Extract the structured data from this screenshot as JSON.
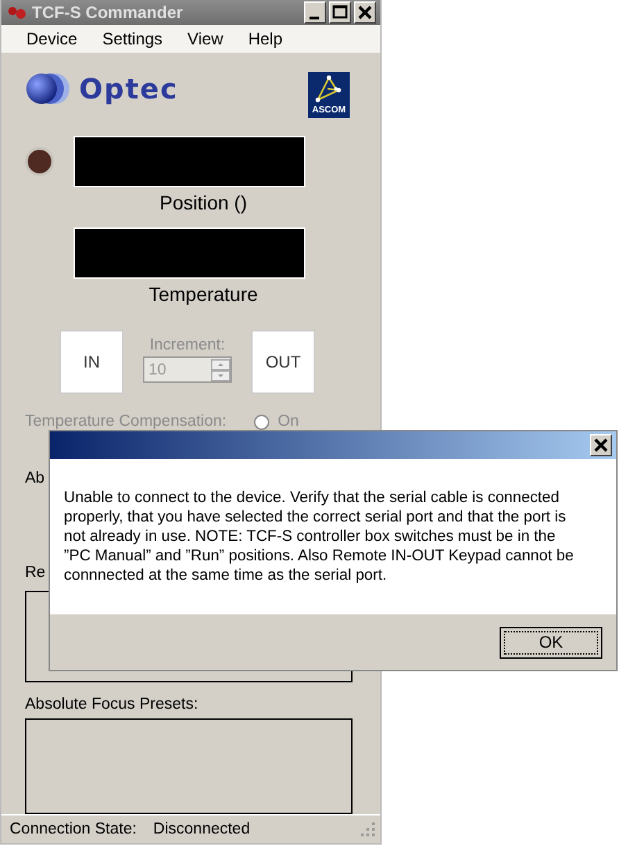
{
  "window": {
    "title": "TCF-S Commander",
    "active": false
  },
  "menu": [
    "Device",
    "Settings",
    "View",
    "Help"
  ],
  "logo": {
    "text": "Optec",
    "badge": "ASCOM"
  },
  "led": {
    "on": false
  },
  "position": {
    "label": "Position ()"
  },
  "temperature": {
    "label": "Temperature"
  },
  "move": {
    "in_button": "IN",
    "out_button": "OUT",
    "increment_label": "Increment:",
    "increment_value": "10",
    "disabled": true
  },
  "temp_compensation": {
    "label": "Temperature Compensation:",
    "option": "On",
    "checked": false,
    "disabled": true
  },
  "hidden_labels": [
    "Ab",
    "Re"
  ],
  "presets": {
    "label": "Absolute Focus Presets:"
  },
  "status_bar": {
    "label": "Connection State:",
    "value": "Disconnected"
  },
  "dialog": {
    "message": "Unable to connect to the device. Verify that the serial cable is connected properly, that you have selected the correct serial port and that the port is not already in use. NOTE: TCF-S controller box switches must be in the ”PC Manual” and ”Run” positions. Also Remote IN-OUT Keypad cannot be connnected at the same time as the serial port.",
    "button": "OK"
  }
}
